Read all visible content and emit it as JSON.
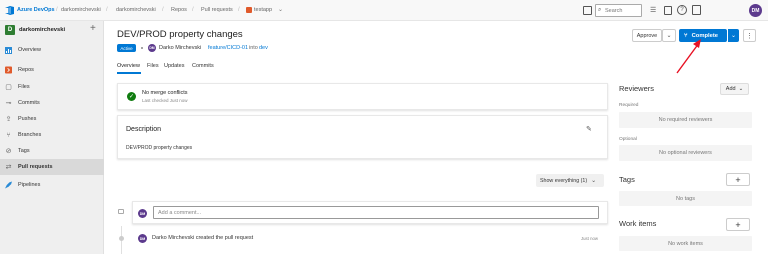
{
  "topbar": {
    "app_name": "Azure DevOps",
    "crumbs": [
      "darkomirchevski",
      "darkomirchevski",
      "Repos",
      "Pull requests",
      "testapp"
    ],
    "search_placeholder": "Search",
    "user_initials": "DM"
  },
  "sidebar": {
    "project_initial": "D",
    "project_name": "darkomirchevski",
    "items": [
      {
        "label": "Overview",
        "icon": "overview-icon"
      },
      {
        "label": "Repos",
        "icon": "repos-icon"
      },
      {
        "label": "Files",
        "icon": "files-icon"
      },
      {
        "label": "Commits",
        "icon": "commits-icon"
      },
      {
        "label": "Pushes",
        "icon": "pushes-icon"
      },
      {
        "label": "Branches",
        "icon": "branches-icon"
      },
      {
        "label": "Tags",
        "icon": "tags-icon"
      },
      {
        "label": "Pull requests",
        "icon": "pull-requests-icon"
      },
      {
        "label": "Pipelines",
        "icon": "pipelines-icon"
      }
    ]
  },
  "pr": {
    "title": "DEV/PROD property changes",
    "status": "Active",
    "author_initials": "DM",
    "author": "Darko Mirchevski",
    "source_branch": "feature/CICD-01",
    "into": "into",
    "target_branch": "dev",
    "tabs": [
      "Overview",
      "Files",
      "Updates",
      "Commits"
    ],
    "approve_label": "Approve",
    "complete_label": "Complete"
  },
  "merge": {
    "title": "No merge conflicts",
    "subtitle": "Last checked Just now"
  },
  "description": {
    "heading": "Description",
    "text": "DEV/PROD property changes"
  },
  "filter": {
    "label": "Show everything (1)"
  },
  "comment": {
    "placeholder": "Add a comment...",
    "user_initials": "DM"
  },
  "activity": {
    "user_initials": "DM",
    "text": "Darko Mirchevski created the pull request",
    "time": "Just now"
  },
  "right_panel": {
    "reviewers_title": "Reviewers",
    "add_label": "Add",
    "required_label": "Required",
    "no_required": "No required reviewers",
    "optional_label": "Optional",
    "no_optional": "No optional reviewers",
    "tags_title": "Tags",
    "no_tags": "No tags",
    "work_items_title": "Work items",
    "no_work_items": "No work items"
  },
  "colors": {
    "accent": "#0078d4",
    "status_active": "#0078d4",
    "success": "#107c10",
    "annotation_arrow": "#e81123",
    "avatar": "#5c3a8d"
  }
}
